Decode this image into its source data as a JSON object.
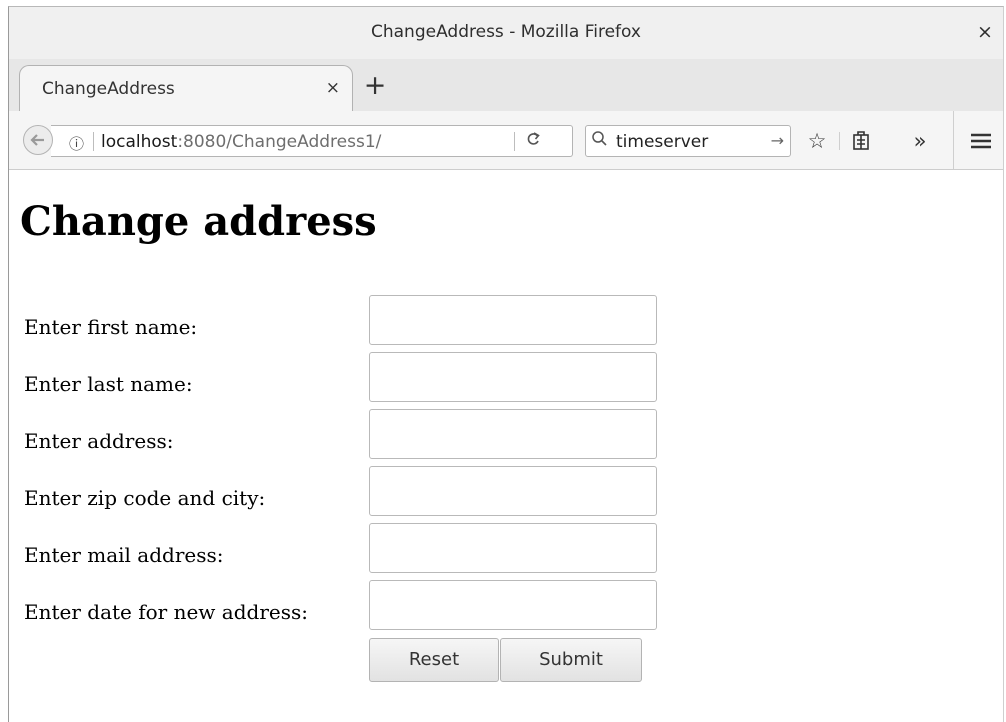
{
  "window": {
    "title": "ChangeAddress - Mozilla Firefox",
    "close_glyph": "×"
  },
  "tabs": [
    {
      "label": "ChangeAddress",
      "close_glyph": "×"
    }
  ],
  "new_tab_glyph": "+",
  "navbar": {
    "back_icon": "back-arrow-icon",
    "url_host": "localhost",
    "url_rest": ":8080/ChangeAddress1/",
    "search_value": "timeserver",
    "icons": [
      "info-icon",
      "reload-icon",
      "search-icon",
      "go-arrow-icon",
      "bookmark-star-icon",
      "reading-list-icon",
      "overflow-chevron-icon",
      "hamburger-menu-icon"
    ]
  },
  "page": {
    "heading": "Change address",
    "fields": [
      {
        "label": "Enter first name:",
        "value": ""
      },
      {
        "label": "Enter last name:",
        "value": ""
      },
      {
        "label": "Enter address:",
        "value": ""
      },
      {
        "label": "Enter zip code and city:",
        "value": ""
      },
      {
        "label": "Enter mail address:",
        "value": ""
      },
      {
        "label": "Enter date for new address:",
        "value": ""
      }
    ],
    "reset_label": "Reset",
    "submit_label": "Submit"
  }
}
